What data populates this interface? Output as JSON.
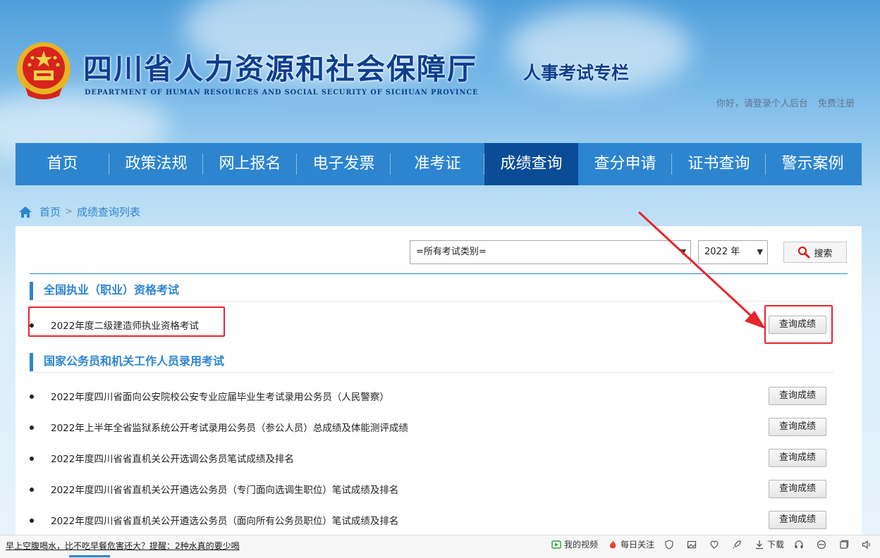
{
  "header": {
    "title": "四川省人力资源和社会保障厅",
    "subtitle": "DEPARTMENT OF HUMAN RESOURCES AND SOCIAL SECURITY OF SICHUAN PROVINCE",
    "tag": "人事考试专栏",
    "login_link": "你好，请登录个人后台",
    "register_link": "免费注册"
  },
  "nav": {
    "items": [
      "首页",
      "政策法规",
      "网上报名",
      "电子发票",
      "准考证",
      "成绩查询",
      "查分申请",
      "证书查询",
      "警示案例"
    ],
    "active": "成绩查询"
  },
  "breadcrumb": {
    "home": "首页",
    "separator": ">",
    "current": "成绩查询列表"
  },
  "filters": {
    "category_value": "=所有考试类别=",
    "year_value": "2022 年",
    "search_label": "搜索"
  },
  "sections": [
    {
      "title": "全国执业（职业）资格考试",
      "items": [
        {
          "text": "2022年度二级建造师执业资格考试",
          "button": "查询成绩"
        }
      ]
    },
    {
      "title": "国家公务员和机关工作人员录用考试",
      "items": [
        {
          "text": "2022年度四川省面向公安院校公安专业应届毕业生考试录用公务员（人民警察）",
          "button": "查询成绩"
        },
        {
          "text": "2022年上半年全省监狱系统公开考试录用公务员（参公人员）总成绩及体能测评成绩",
          "button": "查询成绩"
        },
        {
          "text": "2022年度四川省省直机关公开选调公务员笔试成绩及排名",
          "button": "查询成绩"
        },
        {
          "text": "2022年度四川省省直机关公开遴选公务员（专门面向选调生职位）笔试成绩及排名",
          "button": "查询成绩"
        },
        {
          "text": "2022年度四川省省直机关公开遴选公务员（面向所有公务员职位）笔试成绩及排名",
          "button": "查询成绩"
        }
      ]
    }
  ],
  "statusbar": {
    "news": "早上空腹喝水，比不吃早餐危害还大？提醒：2种水真的要少喝",
    "my_video": "我的视频",
    "daily_follow": "每日关注",
    "download": "下载"
  },
  "colors": {
    "nav_bg": "#2d85cf",
    "nav_active": "#0a4d96",
    "accent": "#2d85cf",
    "highlight": "#e8242c",
    "title": "#0e3f8f"
  }
}
